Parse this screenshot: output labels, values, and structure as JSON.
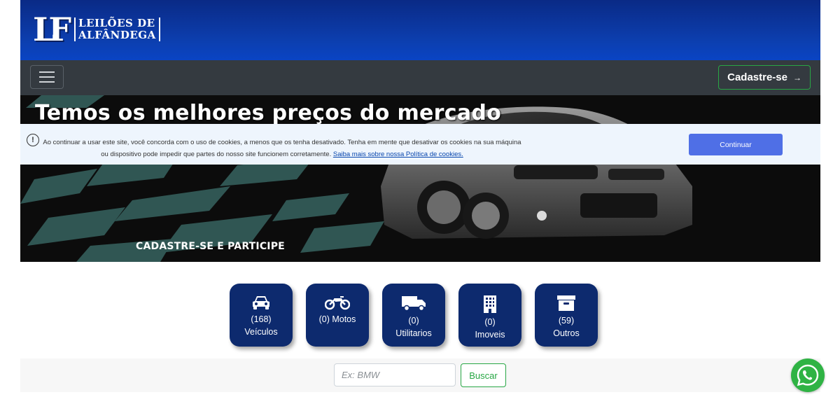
{
  "header": {
    "logo_monogram": "LF",
    "logo_line1": "LEILÕES DE",
    "logo_line2": "ALFÂNDEGA"
  },
  "navbar": {
    "menu_icon": "hamburger-menu-icon",
    "signup_label": "Cadastre-se",
    "signup_arrow": "→"
  },
  "hero": {
    "title": "Temos os melhores preços do mercado",
    "subtitle": "CADASTRE-SE E PARTICIPE"
  },
  "cookie": {
    "icon": "exclamation-circle-icon",
    "text": "Ao continuar a usar este site, você concorda com o uso de cookies, a menos que os tenha desativado. Tenha em mente que desativar os cookies na sua máquina ou dispositivo pode impedir que partes do nosso site funcionem corretamente.",
    "link": "Saiba mais sobre nossa Política de cookies.",
    "button": "Continuar"
  },
  "categories": [
    {
      "icon": "car-icon",
      "count": "(168)",
      "label": "Veículos"
    },
    {
      "icon": "motorcycle-icon",
      "count": "(0) Motos",
      "label": ""
    },
    {
      "icon": "truck-icon",
      "count": "(0)",
      "label": "Utilitarios"
    },
    {
      "icon": "building-icon",
      "count": "(0)",
      "label": "Imoveis"
    },
    {
      "icon": "archive-box-icon",
      "count": "(59)",
      "label": "Outros"
    }
  ],
  "search": {
    "placeholder": "Ex: BMW",
    "value": "",
    "button": "Buscar"
  },
  "whatsapp": {
    "icon": "whatsapp-icon"
  },
  "colors": {
    "header_blue": "#0c3fb0",
    "navbar": "#343a40",
    "category_navy": "#0d2a6e",
    "accent_green": "#28a745",
    "cookie_button": "#4f6fe6"
  }
}
